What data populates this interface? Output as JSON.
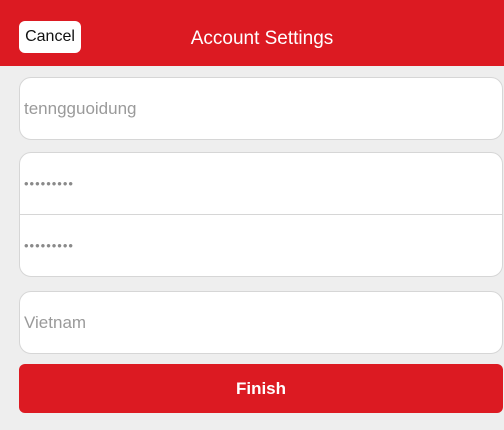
{
  "navbar": {
    "cancel_label": "Cancel",
    "title": "Account Settings"
  },
  "form": {
    "username_value": "tenngguoidung",
    "password_value": "•••••••••",
    "confirm_password_value": "•••••••••",
    "country_value": "Vietnam"
  },
  "footer": {
    "finish_label": "Finish"
  },
  "colors": {
    "brand_red": "#dc1a22",
    "background": "#eeeeee"
  }
}
